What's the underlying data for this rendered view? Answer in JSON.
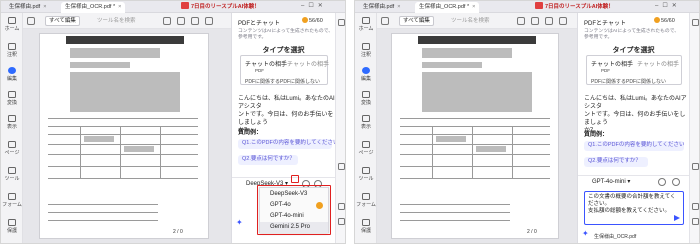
{
  "left": {
    "tabs": [
      "生保様由.pdf",
      "生保様由_OCR.pdf *"
    ],
    "promo": "7日目のリースプルAI体験！",
    "sidebar": [
      "ホーム",
      "注釈",
      "編集",
      "変換",
      "表示",
      "ページ",
      "ツール",
      "フォーム",
      "保護"
    ],
    "toolbar": {
      "select": "すべて編集",
      "search": "ツール名を検索"
    },
    "panel": {
      "title": "PDFとチャット",
      "credit": "56/60",
      "note": [
        "コンテンツはAIによって生成されたもので、",
        "参考用です。"
      ],
      "type_heading": "タイプを選択",
      "type_btn_a": "チャットの相手",
      "type_btn_b": "チャットの相手",
      "type_sub": "PDF",
      "type_foot": "PDFに関係するPDFに関係しない",
      "greeting": [
        "こんにちは、私はLumi。あなたのAIアシスタ",
        "ントです。今日は、何のお手伝いをしましょう",
        "か？"
      ],
      "q_title": "質問例：",
      "q1": "Q1.このPDFの内容を要約してください",
      "q2": "Q2.要点は何ですか？",
      "model": "DeepSeek-V3"
    },
    "dropdown": [
      "DeepSeek-V3",
      "GPT-4o",
      "GPT-4o-mini",
      "Gemini 2.5 Pro"
    ],
    "doc": {
      "pagenav": "2 / 0",
      "zoom": "0"
    }
  },
  "right": {
    "tabs": [
      "生保様由.pdf",
      "生保様由_OCR.pdf *"
    ],
    "promo": "7日目のリースプルAI体験！",
    "sidebar": [
      "ホーム",
      "注釈",
      "編集",
      "変換",
      "表示",
      "ページ",
      "ツール",
      "フォーム",
      "保護"
    ],
    "toolbar": {
      "select": "すべて編集",
      "search": "ツール名を検索"
    },
    "panel": {
      "title": "PDFとチャット",
      "credit": "56/60",
      "note": [
        "コンテンツはAIによって生成されたもので、",
        "参考用です。"
      ],
      "type_heading": "タイプを選択",
      "type_btn_a": "チャットの相手",
      "type_btn_b": "チャットの相手",
      "type_sub": "PDF",
      "type_foot": "PDFに関係するPDFに関係しない",
      "greeting": [
        "こんにちは、私はLumi。あなたのAIアシスタ",
        "ントです。今日は、何のお手伝いをしましょう",
        "か？"
      ],
      "q_title": "質問例：",
      "q1": "Q1.このPDFの内容を要約してください",
      "q2": "Q2.要点は何ですか？",
      "model": "GPT-4o-mini",
      "input": [
        "この文書の概要の合計額を教えてください。",
        "支払額の総額を教えてください。"
      ]
    },
    "footer_file": "生保様由_OCR.pdf",
    "doc": {
      "pagenav": "2 / 0",
      "zoom": "0"
    }
  },
  "colors": {
    "accent": "#3b54ff",
    "highlight": "#e02020",
    "question_bg": "#eef0ff",
    "question_text": "#5a55d6"
  }
}
